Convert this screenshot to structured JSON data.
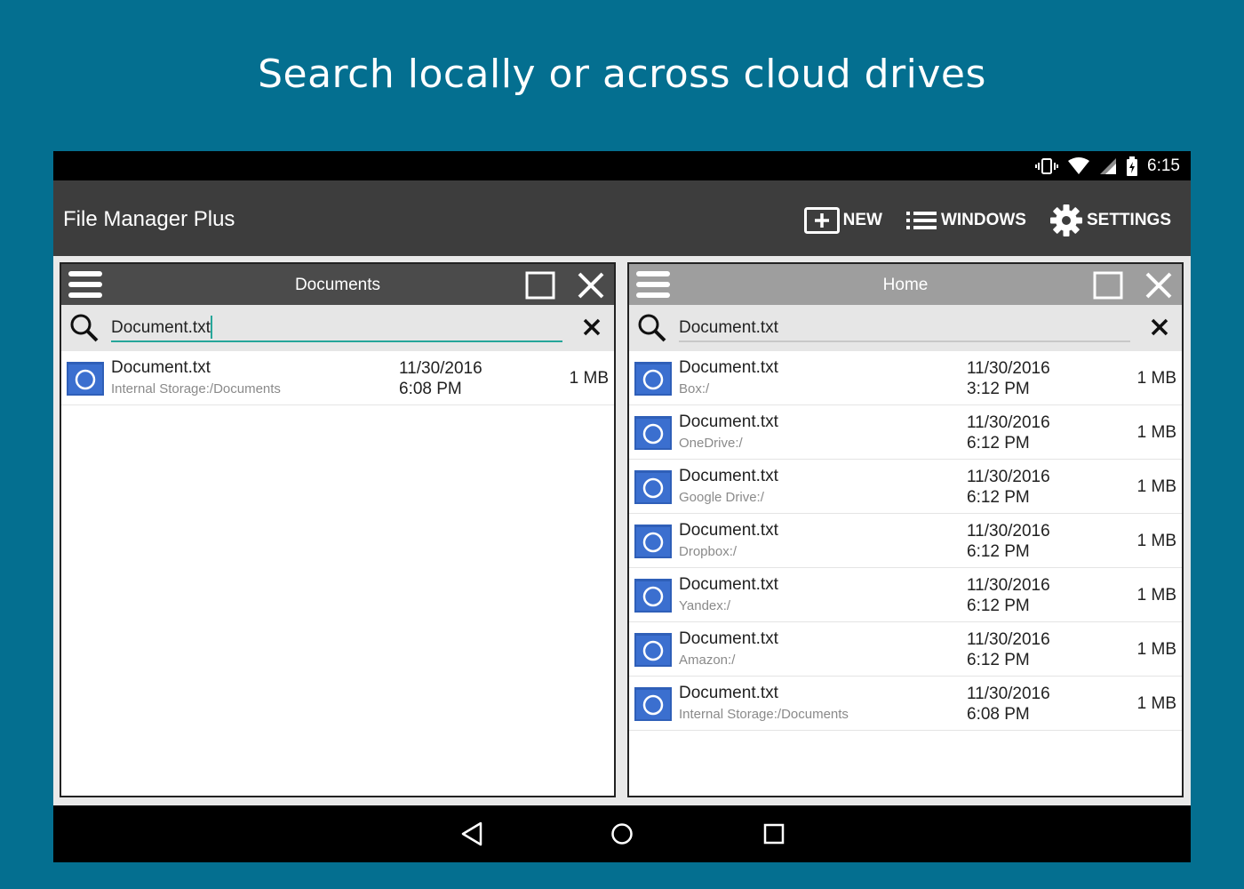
{
  "headline": "Search locally or across cloud drives",
  "status": {
    "time": "6:15"
  },
  "app": {
    "title": "File Manager Plus",
    "actions": {
      "new": "NEW",
      "windows": "WINDOWS",
      "settings": "SETTINGS"
    }
  },
  "panes": {
    "left": {
      "title": "Documents",
      "search_value": "Document.txt",
      "rows": [
        {
          "name": "Document.txt",
          "path": "Internal Storage:/Documents",
          "date": "11/30/2016",
          "time": "6:08 PM",
          "size": "1 MB"
        }
      ]
    },
    "right": {
      "title": "Home",
      "search_value": "Document.txt",
      "rows": [
        {
          "name": "Document.txt",
          "path": "Box:/",
          "date": "11/30/2016",
          "time": "3:12 PM",
          "size": "1 MB"
        },
        {
          "name": "Document.txt",
          "path": "OneDrive:/",
          "date": "11/30/2016",
          "time": "6:12 PM",
          "size": "1 MB"
        },
        {
          "name": "Document.txt",
          "path": "Google Drive:/",
          "date": "11/30/2016",
          "time": "6:12 PM",
          "size": "1 MB"
        },
        {
          "name": "Document.txt",
          "path": "Dropbox:/",
          "date": "11/30/2016",
          "time": "6:12 PM",
          "size": "1 MB"
        },
        {
          "name": "Document.txt",
          "path": "Yandex:/",
          "date": "11/30/2016",
          "time": "6:12 PM",
          "size": "1 MB"
        },
        {
          "name": "Document.txt",
          "path": "Amazon:/",
          "date": "11/30/2016",
          "time": "6:12 PM",
          "size": "1 MB"
        },
        {
          "name": "Document.txt",
          "path": "Internal Storage:/Documents",
          "date": "11/30/2016",
          "time": "6:08 PM",
          "size": "1 MB"
        }
      ]
    }
  },
  "icons": {
    "file": "text-file-icon",
    "menu": "hamburger-menu-icon",
    "maximize": "maximize-icon",
    "close": "close-icon",
    "search": "search-icon",
    "clear": "clear-icon",
    "nav": [
      "back-icon",
      "home-icon",
      "recents-icon"
    ]
  },
  "colors": {
    "background": "#046f90",
    "appbar": "#3d3d3d",
    "active_header": "#4b4b4b",
    "inactive_header": "#9e9e9e",
    "file_icon": "#3b6fcf",
    "search_underline": "#26a69a"
  }
}
